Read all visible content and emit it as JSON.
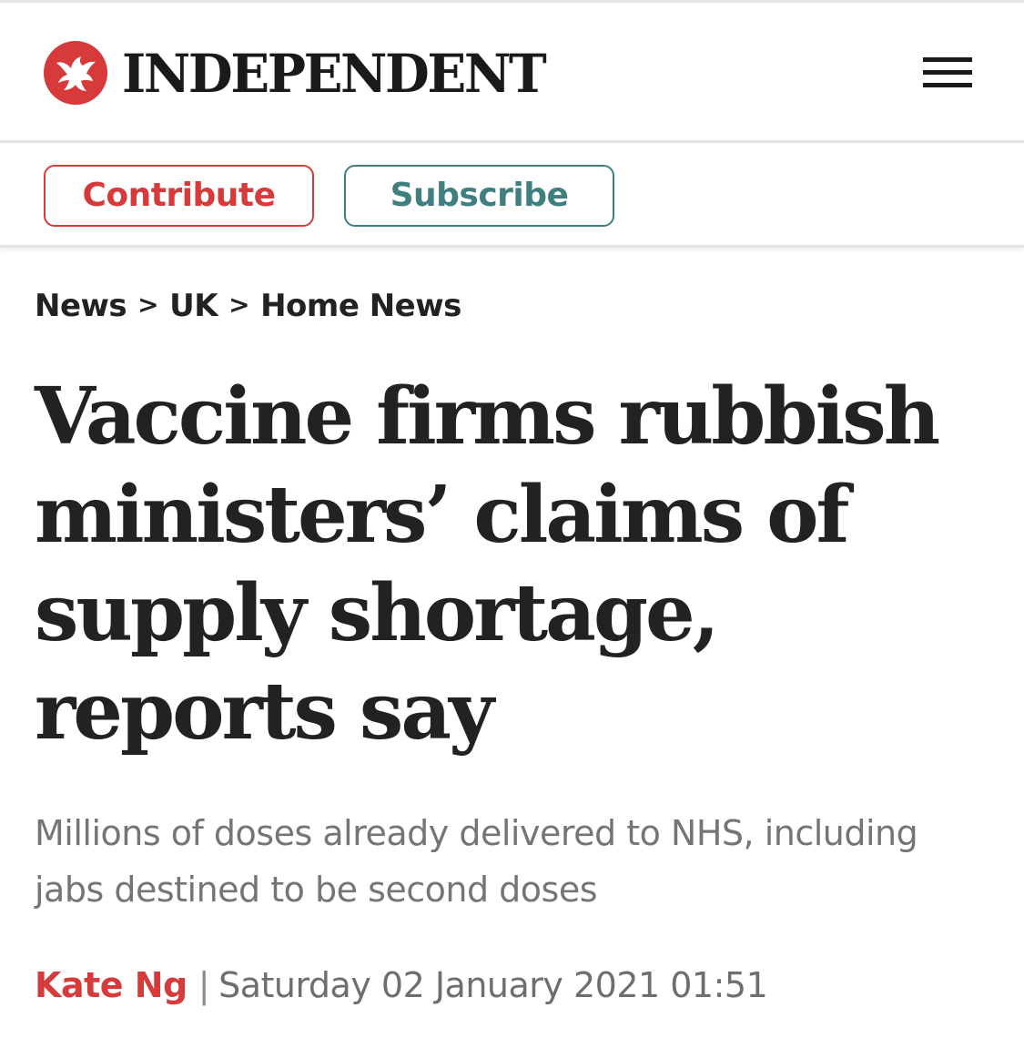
{
  "brand": {
    "name": "INDEPENDENT",
    "accent_color": "#d63a3a",
    "logo_icon": "eagle-icon"
  },
  "header": {
    "menu_icon": "hamburger-menu-icon"
  },
  "actions": {
    "contribute_label": "Contribute",
    "subscribe_label": "Subscribe",
    "contribute_color": "#d63a3a",
    "subscribe_color": "#3f7f80"
  },
  "breadcrumb": {
    "items": [
      "News",
      "UK",
      "Home News"
    ],
    "separator": ">"
  },
  "article": {
    "headline": "Vaccine firms rubbish ministers’ claims of supply shortage, reports say",
    "standfirst": "Millions of doses already delivered to NHS, including jabs destined to be second doses",
    "author": "Kate Ng",
    "byline_separator": "|",
    "published": "Saturday 02 January 2021 01:51"
  }
}
